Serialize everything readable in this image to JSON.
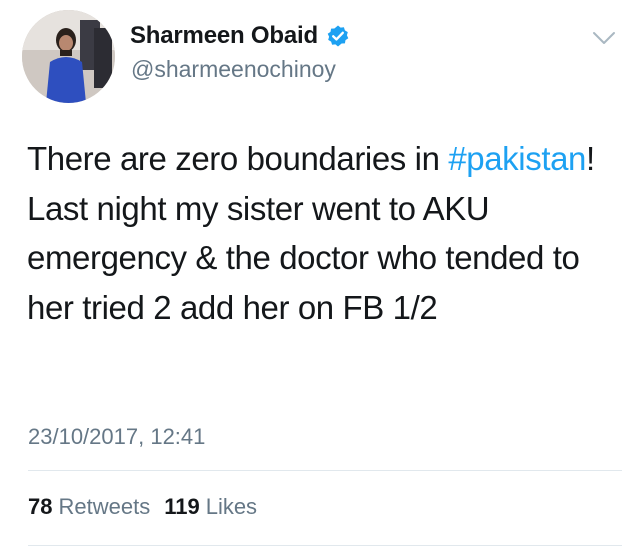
{
  "author": {
    "display_name": "Sharmeen Obaid",
    "handle": "@sharmeenochinoy",
    "verified": true
  },
  "tweet": {
    "text_before": "There are zero boundaries in ",
    "hashtag": "#pakistan",
    "text_after": "! Last night my sister went to AKU emergency & the doctor who tended to her tried 2 add her on FB 1/2",
    "timestamp": "23/10/2017, 12:41"
  },
  "stats": {
    "retweets_count": "78",
    "retweets_label": "Retweets",
    "likes_count": "119",
    "likes_label": "Likes"
  },
  "colors": {
    "link": "#1da1f2",
    "secondary_text": "#657786",
    "primary_text": "#14171a",
    "divider": "#e1e8ed"
  },
  "icons": [
    "verified-badge-icon",
    "chevron-down-icon"
  ]
}
